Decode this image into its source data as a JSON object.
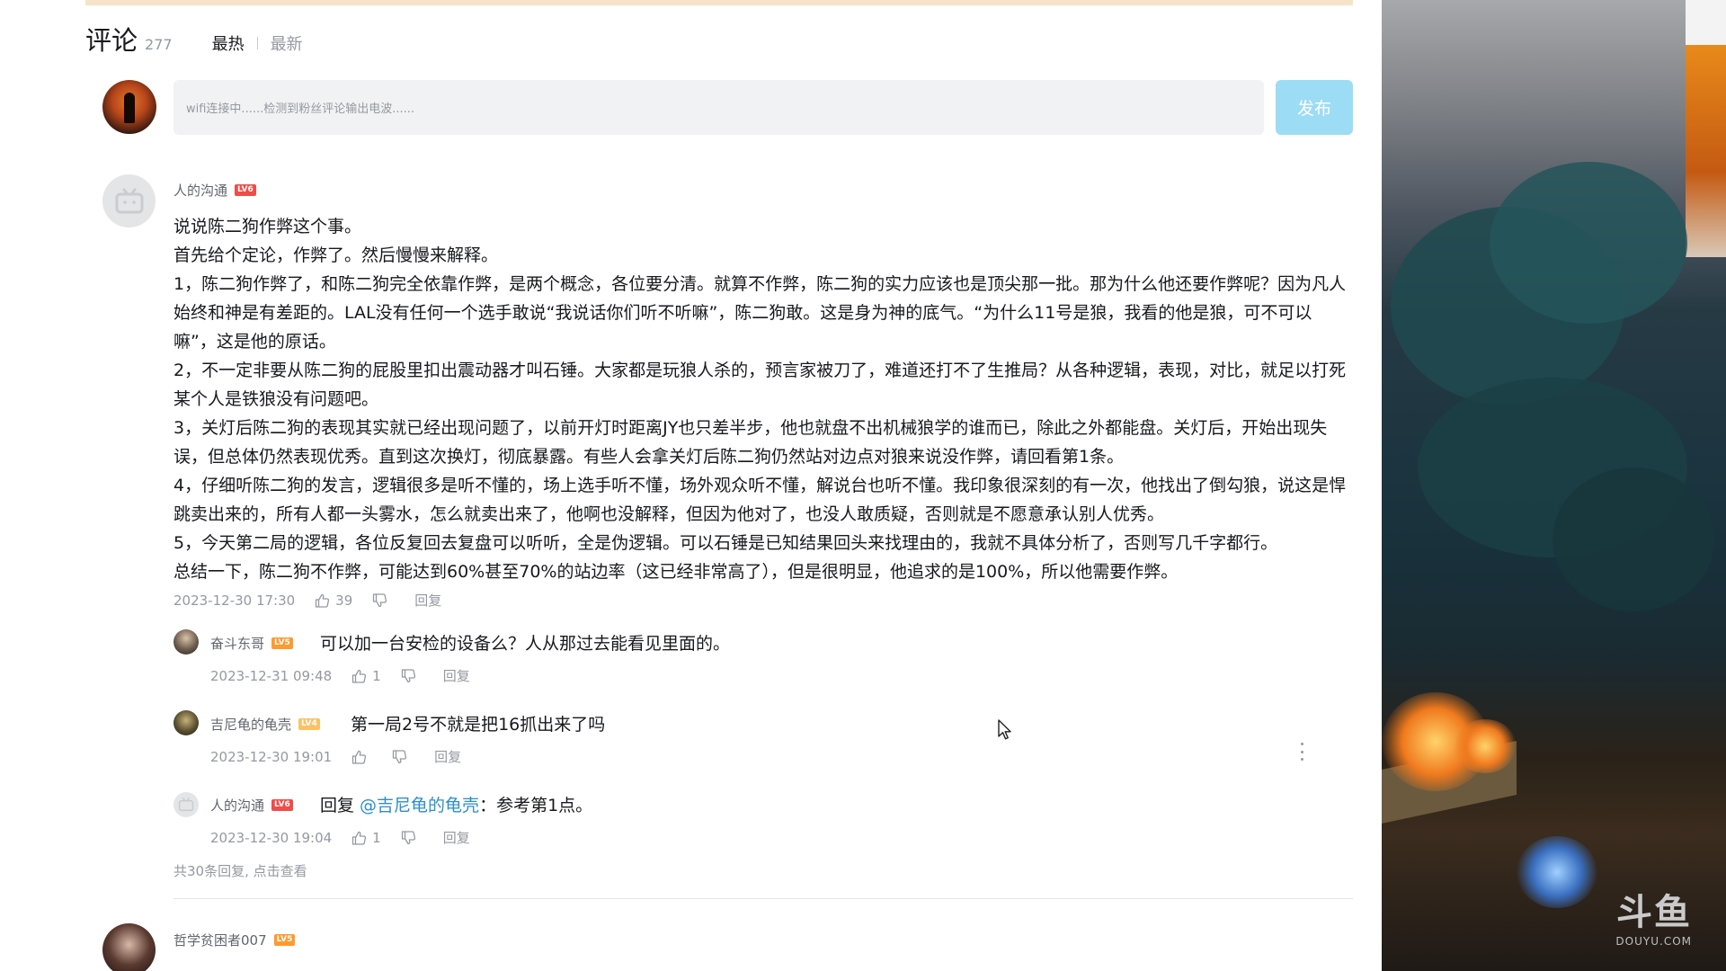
{
  "header": {
    "title": "评论",
    "count": "277",
    "sort_hot": "最热",
    "sort_new": "最新"
  },
  "comment_input": {
    "placeholder": "wifi连接中......检测到粉丝评论输出电波......",
    "publish_label": "发布"
  },
  "main_comment": {
    "username": "人的沟通",
    "level": "LV6",
    "paragraphs": [
      "说说陈二狗作弊这个事。",
      "首先给个定论，作弊了。然后慢慢来解释。",
      "1，陈二狗作弊了，和陈二狗完全依靠作弊，是两个概念，各位要分清。就算不作弊，陈二狗的实力应该也是顶尖那一批。那为什么他还要作弊呢？因为凡人始终和神是有差距的。LAL没有任何一个选手敢说“我说话你们听不听嘛”，陈二狗敢。这是身为神的底气。“为什么11号是狼，我看的他是狼，可不可以嘛”，这是他的原话。",
      "2，不一定非要从陈二狗的屁股里扣出震动器才叫石锤。大家都是玩狼人杀的，预言家被刀了，难道还打不了生推局？从各种逻辑，表现，对比，就足以打死某个人是铁狼没有问题吧。",
      "3，关灯后陈二狗的表现其实就已经出现问题了，以前开灯时距离JY也只差半步，他也就盘不出机械狼学的谁而已，除此之外都能盘。关灯后，开始出现失误，但总体仍然表现优秀。直到这次换灯，彻底暴露。有些人会拿关灯后陈二狗仍然站对边点对狼来说没作弊，请回看第1条。",
      "4，仔细听陈二狗的发言，逻辑很多是听不懂的，场上选手听不懂，场外观众听不懂，解说台也听不懂。我印象很深刻的有一次，他找出了倒勾狼，说这是悍跳卖出来的，所有人都一头雾水，怎么就卖出来了，他啊也没解释，但因为他对了，也没人敢质疑，否则就是不愿意承认别人优秀。",
      "5，今天第二局的逻辑，各位反复回去复盘可以听听，全是伪逻辑。可以石锤是已知结果回头来找理由的，我就不具体分析了，否则写几千字都行。",
      "总结一下，陈二狗不作弊，可能达到60%甚至70%的站边率（这已经非常高了），但是很明显，他追求的是100%，所以他需要作弊。"
    ],
    "date": "2023-12-30 17:30",
    "likes": "39",
    "reply_label": "回复"
  },
  "replies": [
    {
      "username": "奋斗东哥",
      "level": "LV5",
      "text": "可以加一台安检的设备么？人从那过去能看见里面的。",
      "date": "2023-12-31 09:48",
      "likes": "1",
      "reply_label": "回复"
    },
    {
      "username": "吉尼龟的龟壳",
      "level": "LV4",
      "text": "第一局2号不就是把16抓出来了吗",
      "date": "2023-12-30 19:01",
      "likes": "",
      "reply_label": "回复"
    },
    {
      "username": "人的沟通",
      "level": "LV6",
      "prefix": "回复 ",
      "mention": "@吉尼龟的龟壳",
      "text": "：参考第1点。",
      "date": "2023-12-30 19:04",
      "likes": "1",
      "reply_label": "回复"
    }
  ],
  "more_replies": "共30条回复, 点击查看",
  "next_comment": {
    "username": "哲学贫困者007",
    "level": "LV5"
  },
  "stream_panel": {
    "logo_text": "斗鱼",
    "logo_sub": "DOUYU.COM"
  },
  "colors": {
    "accent_blue": "#9ddcf5",
    "mention_blue": "#2c8ecf",
    "level_red": "#f04c49",
    "level_orange": "#ff9a2e",
    "level_gold": "#fcc165",
    "muted_text": "#9499a0"
  }
}
